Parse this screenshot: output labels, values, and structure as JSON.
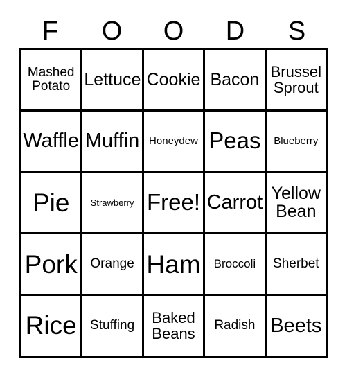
{
  "card": {
    "title_letters": [
      "F",
      "O",
      "O",
      "D",
      "S"
    ],
    "free_space_label": "Free!",
    "colors": {
      "background": "#ffffff",
      "border": "#000000",
      "text": "#000000"
    },
    "grid": {
      "rows": 5,
      "columns": 5,
      "cells": [
        [
          {
            "label": "Mashed\nPotato",
            "size": "md"
          },
          {
            "label": "Lettuce",
            "size": "xl"
          },
          {
            "label": "Cookie",
            "size": "xl"
          },
          {
            "label": "Bacon",
            "size": "xl"
          },
          {
            "label": "Brussel\nSprout",
            "size": "lg"
          }
        ],
        [
          {
            "label": "Waffle",
            "size": "xxl"
          },
          {
            "label": "Muffin",
            "size": "xxl"
          },
          {
            "label": "Honeydew",
            "size": "sm"
          },
          {
            "label": "Peas",
            "size": "huge"
          },
          {
            "label": "Blueberry",
            "size": "sm"
          }
        ],
        [
          {
            "label": "Pie",
            "size": "mega"
          },
          {
            "label": "Strawberry",
            "size": "xs"
          },
          {
            "label": "Free!",
            "size": "huge"
          },
          {
            "label": "Carrot",
            "size": "xxl"
          },
          {
            "label": "Yellow\nBean",
            "size": "xl"
          }
        ],
        [
          {
            "label": "Pork",
            "size": "mega"
          },
          {
            "label": "Orange",
            "size": "md"
          },
          {
            "label": "Ham",
            "size": "mega"
          },
          {
            "label": "Broccoli",
            "size": "smd"
          },
          {
            "label": "Sherbet",
            "size": "md"
          }
        ],
        [
          {
            "label": "Rice",
            "size": "mega"
          },
          {
            "label": "Stuffing",
            "size": "md"
          },
          {
            "label": "Baked\nBeans",
            "size": "lg"
          },
          {
            "label": "Radish",
            "size": "md"
          },
          {
            "label": "Beets",
            "size": "xxl"
          }
        ]
      ]
    }
  }
}
